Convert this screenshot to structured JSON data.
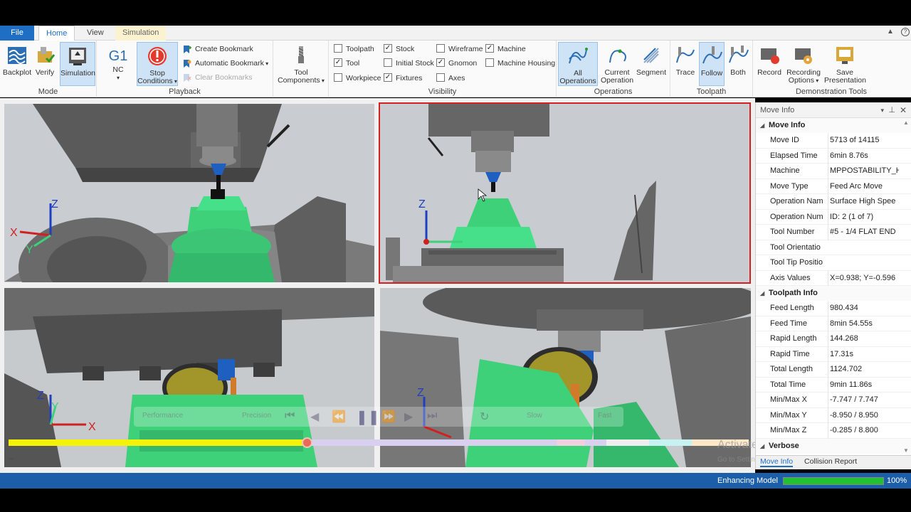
{
  "tabs": [
    {
      "label": "File"
    },
    {
      "label": "Home"
    },
    {
      "label": "View"
    },
    {
      "label": "Simulation"
    }
  ],
  "ribbon": {
    "mode": {
      "label": "Mode",
      "buttons": [
        {
          "label": "Backplot"
        },
        {
          "label": "Verify"
        },
        {
          "label": "Simulation"
        }
      ]
    },
    "playback": {
      "label": "Playback",
      "nc_label": "NC",
      "g1_text": "G1",
      "stop_label_1": "Stop",
      "stop_label_2": "Conditions",
      "create_bookmark": "Create Bookmark",
      "automatic_bookmark": "Automatic Bookmark",
      "clear_bookmarks": "Clear Bookmarks"
    },
    "tool_components": {
      "label_1": "Tool",
      "label_2": "Components"
    },
    "visibility": {
      "label": "Visibility",
      "items": [
        {
          "label": "Toolpath",
          "checked": false
        },
        {
          "label": "Tool",
          "checked": true
        },
        {
          "label": "Workpiece",
          "checked": false
        },
        {
          "label": "Stock",
          "checked": true
        },
        {
          "label": "Initial Stock",
          "checked": false
        },
        {
          "label": "Fixtures",
          "checked": true
        },
        {
          "label": "Wireframe",
          "checked": false
        },
        {
          "label": "Gnomon",
          "checked": true
        },
        {
          "label": "Axes",
          "checked": false
        },
        {
          "label": "Machine",
          "checked": true
        },
        {
          "label": "Machine Housing",
          "checked": false
        }
      ]
    },
    "operations": {
      "label": "Operations",
      "all_1": "All",
      "all_2": "Operations",
      "current_1": "Current",
      "current_2": "Operation",
      "segment": "Segment"
    },
    "toolpath": {
      "label": "Toolpath",
      "trace": "Trace",
      "follow": "Follow",
      "both": "Both"
    },
    "demo": {
      "label": "Demonstration Tools",
      "record": "Record",
      "rec_opt_1": "Recording",
      "rec_opt_2": "Options",
      "save_1": "Save",
      "save_2": "Presentation"
    }
  },
  "panel": {
    "title": "Move Info",
    "sections": [
      {
        "title": "Move Info",
        "rows": [
          {
            "key": "Move ID",
            "value": "5713 of 14115"
          },
          {
            "key": "Elapsed Time",
            "value": "6min 8.76s"
          },
          {
            "key": "Machine",
            "value": "MPPOSTABILITY_H"
          },
          {
            "key": "Move Type",
            "value": "Feed Arc Move"
          },
          {
            "key": "Operation Nam",
            "value": "Surface High Spee"
          },
          {
            "key": "Operation Num",
            "value": "ID: 2 (1 of 7)"
          },
          {
            "key": "Tool Number",
            "value": "#5 - 1/4 FLAT END"
          },
          {
            "key": "Tool Orientatio",
            "value": ""
          },
          {
            "key": "Tool Tip Positio",
            "value": ""
          },
          {
            "key": "Axis Values",
            "value": "X=0.938; Y=-0.596"
          }
        ]
      },
      {
        "title": "Toolpath Info",
        "rows": [
          {
            "key": "Feed Length",
            "value": "980.434"
          },
          {
            "key": "Feed Time",
            "value": "8min 54.55s"
          },
          {
            "key": "Rapid Length",
            "value": "144.268"
          },
          {
            "key": "Rapid Time",
            "value": "17.31s"
          },
          {
            "key": "Total Length",
            "value": "1124.702"
          },
          {
            "key": "Total Time",
            "value": "9min 11.86s"
          },
          {
            "key": "Min/Max X",
            "value": "-7.747 / 7.747"
          },
          {
            "key": "Min/Max Y",
            "value": "-8.950 / 8.950"
          },
          {
            "key": "Min/Max Z",
            "value": "-0.285 / 8.800"
          }
        ]
      },
      {
        "title": "Verbose",
        "rows": []
      }
    ],
    "tabs": [
      {
        "label": "Move Info"
      },
      {
        "label": "Collision Report"
      }
    ]
  },
  "playback_overlay": {
    "performance": "Performance",
    "precision": "Precision",
    "slow": "Slow",
    "fast": "Fast",
    "progress": 0.34
  },
  "watermark": {
    "line1": "Activate Windows",
    "line2": "Go to Settings to activate Windows."
  },
  "status": {
    "text": "Enhancing Model",
    "percent": "100%",
    "progress": 1.0
  },
  "axes": {
    "x": "X",
    "y": "Y",
    "z": "Z"
  },
  "colors": {
    "accent": "#1e6fc4",
    "part": "#3fd17a",
    "selection": "#d32020",
    "status_bar": "#1c5ea8"
  }
}
